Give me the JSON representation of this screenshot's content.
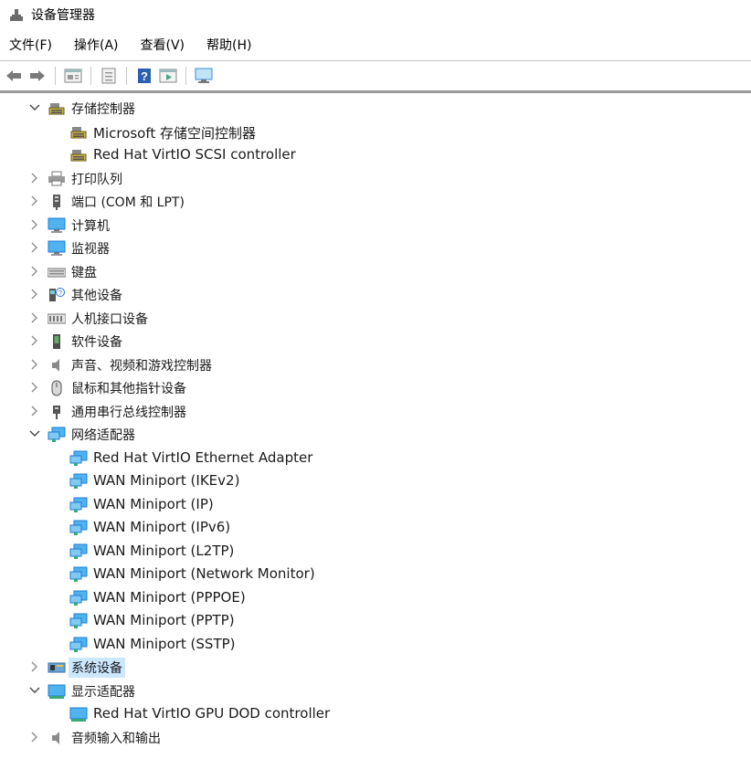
{
  "window": {
    "title": "设备管理器"
  },
  "menu": [
    {
      "label": "文件(F)"
    },
    {
      "label": "操作(A)"
    },
    {
      "label": "查看(V)"
    },
    {
      "label": "帮助(H)"
    }
  ],
  "toolbar": {
    "buttons": [
      "back-arrow-icon",
      "forward-arrow-icon",
      "properties-icon",
      "update-driver-icon",
      "help-icon",
      "run-icon",
      "monitor-icon"
    ]
  },
  "tree": [
    {
      "level": 0,
      "expanded": true,
      "icon": "storage-controller-icon",
      "label": "存储控制器"
    },
    {
      "level": 1,
      "icon": "storage-controller-icon",
      "label": "Microsoft 存储空间控制器"
    },
    {
      "level": 1,
      "icon": "storage-controller-icon",
      "label": "Red Hat VirtIO SCSI controller"
    },
    {
      "level": 0,
      "expanded": false,
      "icon": "printer-icon",
      "label": "打印队列"
    },
    {
      "level": 0,
      "expanded": false,
      "icon": "port-icon",
      "label": "端口 (COM 和 LPT)"
    },
    {
      "level": 0,
      "expanded": false,
      "icon": "computer-icon",
      "label": "计算机"
    },
    {
      "level": 0,
      "expanded": false,
      "icon": "monitor-icon",
      "label": "监视器"
    },
    {
      "level": 0,
      "expanded": false,
      "icon": "keyboard-icon",
      "label": "键盘"
    },
    {
      "level": 0,
      "expanded": false,
      "icon": "unknown-device-icon",
      "label": "其他设备"
    },
    {
      "level": 0,
      "expanded": false,
      "icon": "hid-icon",
      "label": "人机接口设备"
    },
    {
      "level": 0,
      "expanded": false,
      "icon": "software-device-icon",
      "label": "软件设备"
    },
    {
      "level": 0,
      "expanded": false,
      "icon": "speaker-icon",
      "label": "声音、视频和游戏控制器"
    },
    {
      "level": 0,
      "expanded": false,
      "icon": "mouse-icon",
      "label": "鼠标和其他指针设备"
    },
    {
      "level": 0,
      "expanded": false,
      "icon": "usb-icon",
      "label": "通用串行总线控制器"
    },
    {
      "level": 0,
      "expanded": true,
      "icon": "network-adapter-icon",
      "label": "网络适配器"
    },
    {
      "level": 1,
      "icon": "network-adapter-icon",
      "label": "Red Hat VirtIO Ethernet Adapter"
    },
    {
      "level": 1,
      "icon": "network-adapter-icon",
      "label": "WAN Miniport (IKEv2)"
    },
    {
      "level": 1,
      "icon": "network-adapter-icon",
      "label": "WAN Miniport (IP)"
    },
    {
      "level": 1,
      "icon": "network-adapter-icon",
      "label": "WAN Miniport (IPv6)"
    },
    {
      "level": 1,
      "icon": "network-adapter-icon",
      "label": "WAN Miniport (L2TP)"
    },
    {
      "level": 1,
      "icon": "network-adapter-icon",
      "label": "WAN Miniport (Network Monitor)"
    },
    {
      "level": 1,
      "icon": "network-adapter-icon",
      "label": "WAN Miniport (PPPOE)"
    },
    {
      "level": 1,
      "icon": "network-adapter-icon",
      "label": "WAN Miniport (PPTP)"
    },
    {
      "level": 1,
      "icon": "network-adapter-icon",
      "label": "WAN Miniport (SSTP)"
    },
    {
      "level": 0,
      "expanded": false,
      "icon": "system-device-icon",
      "label": "系统设备",
      "selected": true
    },
    {
      "level": 0,
      "expanded": true,
      "icon": "display-adapter-icon",
      "label": "显示适配器"
    },
    {
      "level": 1,
      "icon": "display-adapter-icon",
      "label": "Red Hat VirtIO GPU DOD controller"
    },
    {
      "level": 0,
      "expanded": false,
      "icon": "speaker-icon",
      "label": "音频输入和输出"
    }
  ],
  "colors": {
    "selection": "#cce8ff",
    "accent": "#1e7bd6",
    "icon_blue": "#2a8fe0"
  }
}
